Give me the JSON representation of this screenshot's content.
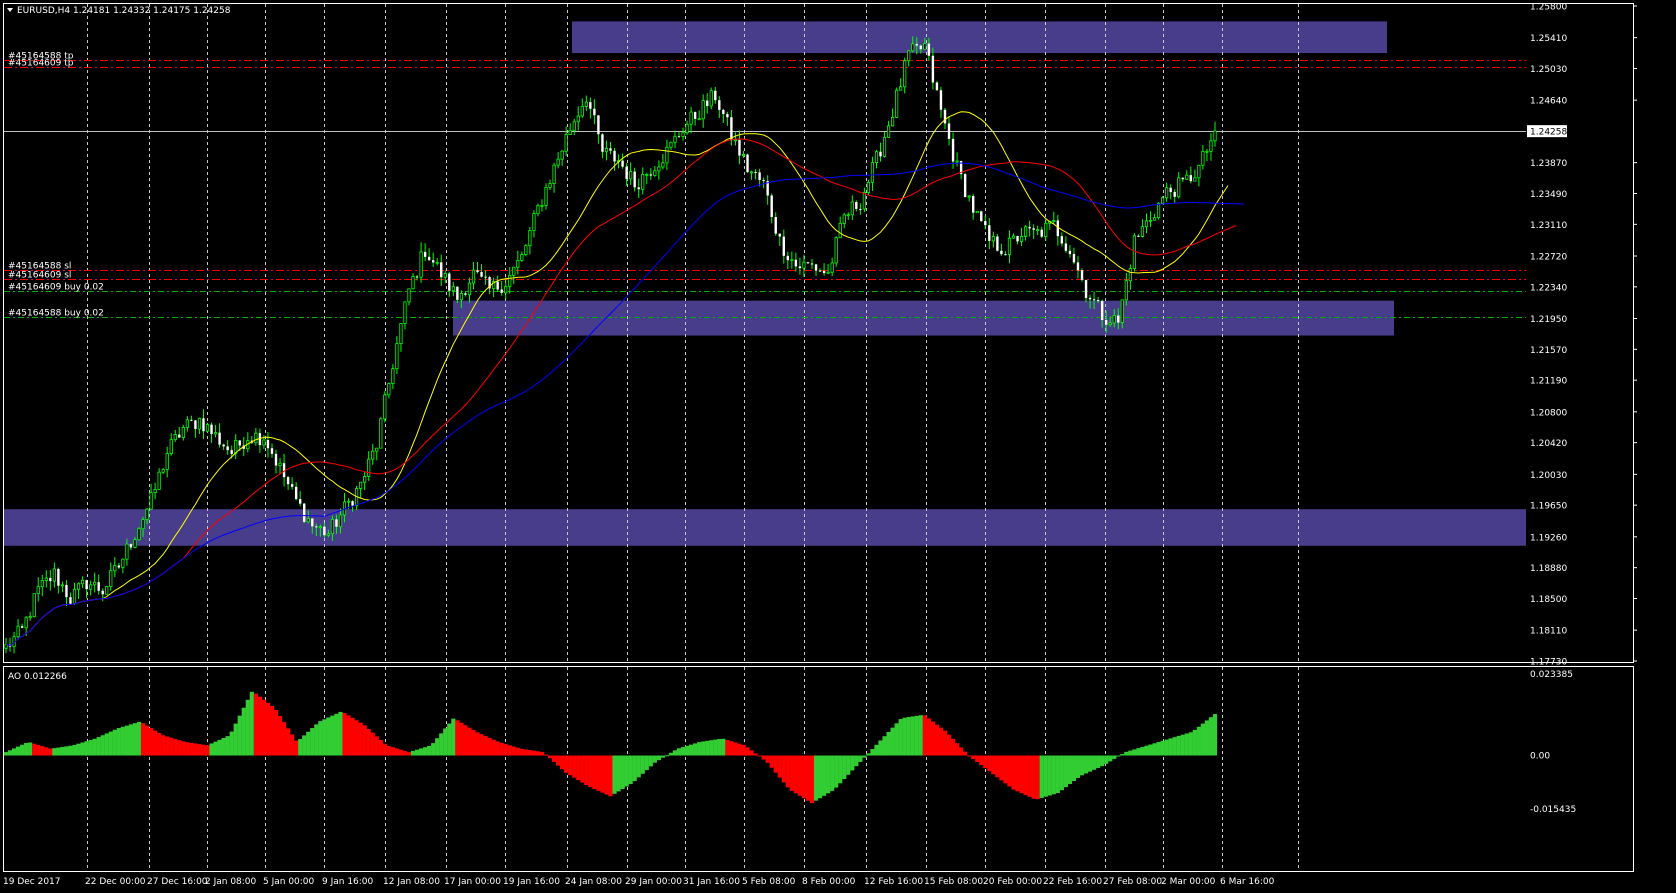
{
  "window": {
    "symbol_label": "EURUSD,H4",
    "ohlc": "1.24181 1.24332 1.24175 1.24258"
  },
  "ao_panel": {
    "label": "AO 0.012266"
  },
  "colors": {
    "background": "#000000",
    "zone": "#483d8b",
    "bull": "#00ff00",
    "ma_fast": "#ffff00",
    "ma_mid": "#ff0000",
    "ma_slow": "#0000ff",
    "ao_up": "#32cd32",
    "ao_down": "#ff0000",
    "sl_tp_line": "#ff0000",
    "entry_line": "#00b000",
    "grid": "#c8c8c8"
  },
  "chart_data": [
    {
      "type": "candlestick",
      "title": "",
      "ylim": [
        1.1773,
        1.258
      ],
      "y_ticks": [
        "1.25800",
        "1.25410",
        "1.25030",
        "1.24640",
        "1.24258",
        "1.23870",
        "1.23490",
        "1.23110",
        "1.22720",
        "1.22340",
        "1.21950",
        "1.21570",
        "1.21190",
        "1.20800",
        "1.20420",
        "1.20030",
        "1.19650",
        "1.19260",
        "1.18880",
        "1.18500",
        "1.18110",
        "1.17730"
      ],
      "current_price": "1.24258",
      "x_ticks": [
        "19 Dec 2017",
        "22 Dec 00:00",
        "27 Dec 16:00",
        "2 Jan 08:00",
        "5 Jan 00:00",
        "9 Jan 16:00",
        "12 Jan 08:00",
        "17 Jan 00:00",
        "19 Jan 16:00",
        "24 Jan 08:00",
        "29 Jan 00:00",
        "31 Jan 16:00",
        "5 Feb 08:00",
        "8 Feb 00:00",
        "12 Feb 16:00",
        "15 Feb 08:00",
        "20 Feb 00:00",
        "22 Feb 16:00",
        "27 Feb 08:00",
        "2 Mar 00:00",
        "6 Mar 16:00"
      ],
      "anchor_prices": [
        1.179,
        1.181,
        1.186,
        1.188,
        1.185,
        1.187,
        1.186,
        1.189,
        1.193,
        1.197,
        1.203,
        1.206,
        1.207,
        1.205,
        1.203,
        1.205,
        1.205,
        1.201,
        1.197,
        1.194,
        1.193,
        1.196,
        1.199,
        1.204,
        1.214,
        1.223,
        1.228,
        1.225,
        1.222,
        1.225,
        1.223,
        1.224,
        1.227,
        1.233,
        1.238,
        1.243,
        1.247,
        1.24,
        1.239,
        1.236,
        1.238,
        1.24,
        1.243,
        1.245,
        1.247,
        1.242,
        1.238,
        1.236,
        1.229,
        1.226,
        1.226,
        1.225,
        1.232,
        1.234,
        1.239,
        1.245,
        1.252,
        1.253,
        1.245,
        1.238,
        1.233,
        1.229,
        1.228,
        1.23,
        1.23,
        1.231,
        1.228,
        1.223,
        1.22,
        1.219,
        1.229,
        1.232,
        1.235,
        1.236,
        1.238,
        1.2426
      ],
      "moving_averages": [
        {
          "color": "#ffff00",
          "period": 5
        },
        {
          "color": "#ff0000",
          "period": 9
        },
        {
          "color": "#0000ff",
          "period": 16
        }
      ],
      "zones": [
        {
          "from": 1.2522,
          "to": 1.2561,
          "x_start": "24 Jan 08:00",
          "x_end": "6 Mar 16:00+"
        },
        {
          "from": 1.2174,
          "to": 1.2217,
          "x_start": "17 Jan 00:00",
          "x_end": "6 Mar 16:00+"
        },
        {
          "from": 1.1915,
          "to": 1.196,
          "x_start": "19 Dec 2017",
          "x_end": "right edge"
        }
      ],
      "order_lines": [
        {
          "label": "#45164588 tp",
          "price": 1.2514,
          "kind": "tp"
        },
        {
          "label": "#45164609 tp",
          "price": 1.2505,
          "kind": "tp"
        },
        {
          "label": "#45164588 sl",
          "price": 1.2255,
          "kind": "sl"
        },
        {
          "label": "#45164609 sl",
          "price": 1.2244,
          "kind": "sl"
        },
        {
          "label": "#45164609 buy 0.02",
          "price": 1.2229,
          "kind": "entry"
        },
        {
          "label": "#45164588 buy 0.02",
          "price": 1.2197,
          "kind": "entry"
        }
      ]
    },
    {
      "type": "bar",
      "title": "",
      "series_name": "AO",
      "ylim": [
        -0.015435,
        0.023385
      ],
      "y_ticks": [
        "0.023385",
        "0.00",
        "-0.015435"
      ],
      "shape_anchors": [
        0.001,
        0.004,
        0.002,
        0.003,
        0.005,
        0.008,
        0.01,
        0.006,
        0.004,
        0.003,
        0.006,
        0.019,
        0.014,
        0.004,
        0.01,
        0.013,
        0.009,
        0.003,
        0.001,
        0.003,
        0.011,
        0.007,
        0.004,
        0.002,
        0.001,
        -0.005,
        -0.009,
        -0.012,
        -0.008,
        -0.002,
        0.002,
        0.004,
        0.005,
        0.003,
        -0.002,
        -0.01,
        -0.014,
        -0.01,
        -0.003,
        0.004,
        0.011,
        0.012,
        0.007,
        0.0,
        -0.005,
        -0.01,
        -0.013,
        -0.011,
        -0.006,
        -0.003,
        0.001,
        0.003,
        0.005,
        0.007,
        0.0122
      ]
    }
  ]
}
